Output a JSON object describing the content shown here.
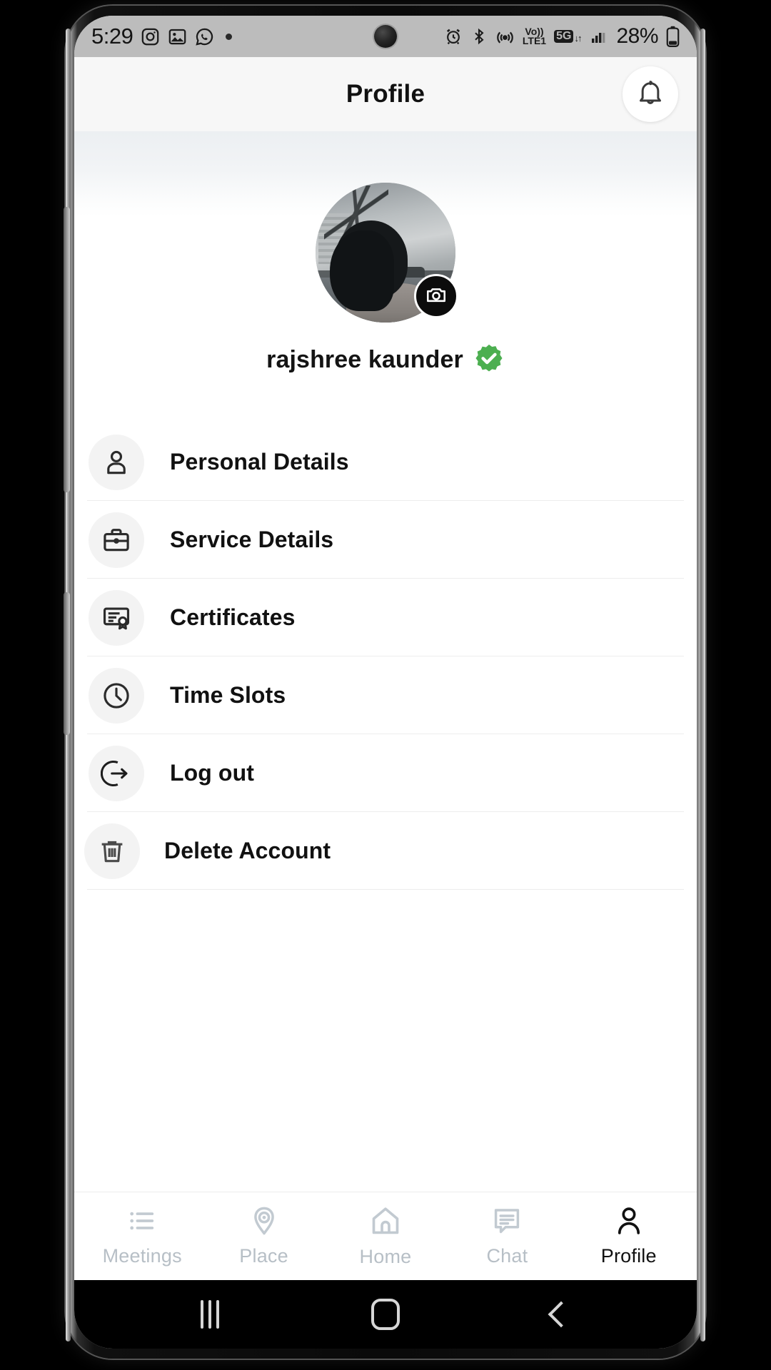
{
  "status_bar": {
    "time": "5:29",
    "app_icons": [
      "instagram-icon",
      "gallery-icon",
      "whatsapp-icon",
      "notification-dot"
    ],
    "alarm_icon": "alarm-icon",
    "bluetooth_icon": "bluetooth-icon",
    "hotspot_icon": "hotspot-icon",
    "volte_top": "Vo))",
    "volte_bottom": "LTE1",
    "network_type": "5G",
    "network_arrows": "↓↑",
    "signal_icon": "signal-bars-icon",
    "battery_percent": "28%",
    "battery_icon": "battery-icon"
  },
  "header": {
    "title": "Profile",
    "notification_icon": "bell-icon"
  },
  "profile": {
    "avatar_alt": "user-profile-photo",
    "camera_badge_icon": "camera-icon",
    "name": "rajshree  kaunder",
    "verified_icon": "verified-badge-icon",
    "verified_color": "#4CAF50"
  },
  "menu": {
    "items": [
      {
        "label": "Personal Details",
        "icon": "person-icon"
      },
      {
        "label": "Service Details",
        "icon": "briefcase-icon"
      },
      {
        "label": "Certificates",
        "icon": "certificate-icon"
      },
      {
        "label": "Time Slots",
        "icon": "clock-icon"
      },
      {
        "label": "Log out",
        "icon": "logout-icon"
      },
      {
        "label": "Delete Account",
        "icon": "trash-icon"
      }
    ]
  },
  "bottom_nav": {
    "items": [
      {
        "label": "Meetings",
        "icon": "list-icon",
        "active": false
      },
      {
        "label": "Place",
        "icon": "location-icon",
        "active": false
      },
      {
        "label": "Home",
        "icon": "home-icon",
        "active": false
      },
      {
        "label": "Chat",
        "icon": "chat-icon",
        "active": false
      },
      {
        "label": "Profile",
        "icon": "person-icon",
        "active": true
      }
    ],
    "inactive_color": "#b7bfc6",
    "active_color": "#111111"
  },
  "android_nav": {
    "recents_icon": "recents-icon",
    "home_icon": "home-square-icon",
    "back_icon": "back-chevron-icon"
  }
}
